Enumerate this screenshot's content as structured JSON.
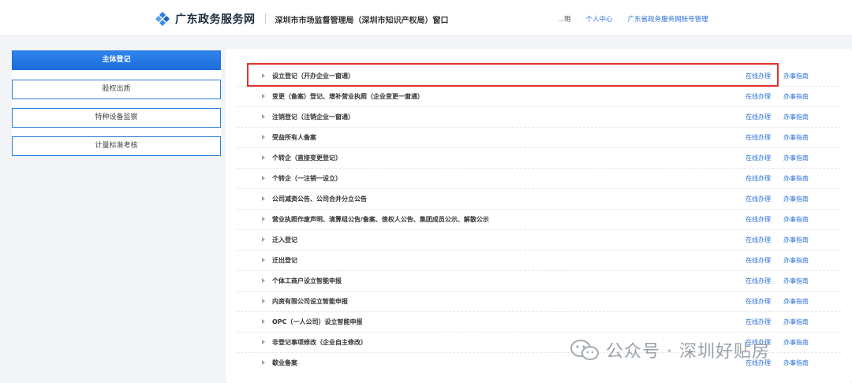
{
  "header": {
    "site_name": "广东政务服务网",
    "department": "深圳市市场监督管理局（深圳市知识产权局）窗口",
    "nav": [
      "...明",
      "个人中心",
      "广东省政务服务网账号管理"
    ]
  },
  "sidebar": {
    "items": [
      {
        "label": "主体登记",
        "active": true
      },
      {
        "label": "股权出质",
        "active": false
      },
      {
        "label": "特种设备监察",
        "active": false
      },
      {
        "label": "计量标准考核",
        "active": false
      }
    ]
  },
  "services": {
    "op_label": "在线办理",
    "guide_label": "办事指南",
    "items": [
      "设立登记（开办企业一窗通）",
      "变更（备案）登记、增补营业执照（企业变更一窗通）",
      "注销登记（注销企业一窗通）",
      "受益所有人备案",
      "个转企（直接变更登记）",
      "个转企（一注销一设立）",
      "公司减资公告、公司合并分立公告",
      "营业执照作废声明、清算组公告/备案、债权人公告、集团成员公示、解散公示",
      "迁入登记",
      "迁出登记",
      "个体工商户设立智能申报",
      "内资有限公司设立智能申报",
      "OPC（一人公司）设立智能申报",
      "非登记事项修改（企业自主修改）",
      "歇业备案"
    ]
  },
  "watermark": {
    "text": "公众号 · 深圳好贴房"
  },
  "colors": {
    "accent": "#2a6fdb",
    "sidebar_active": "#1d6ddb",
    "highlight": "#e0312b"
  }
}
